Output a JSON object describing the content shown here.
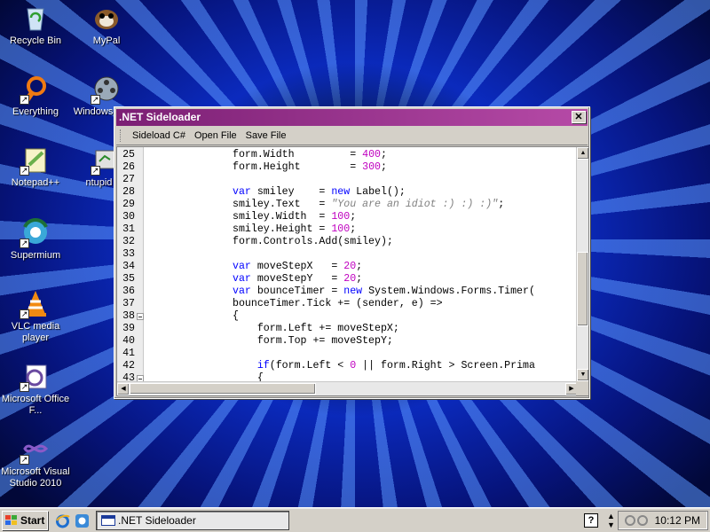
{
  "desktop": {
    "icons": [
      {
        "label": "Recycle Bin",
        "icon": "recycle-bin-icon"
      },
      {
        "label": "MyPal",
        "icon": "mypal-icon"
      },
      {
        "label": "Everything",
        "icon": "everything-icon"
      },
      {
        "label": "Windows Make",
        "icon": "movie-maker-icon"
      },
      {
        "label": "Notepad++",
        "icon": "notepadpp-icon"
      },
      {
        "label": "ntupid sig",
        "icon": "ntupid-icon"
      },
      {
        "label": "Supermium",
        "icon": "supermium-icon"
      },
      {
        "label": "VLC media player",
        "icon": "vlc-icon"
      },
      {
        "label": "Microsoft Office F...",
        "icon": "office-icon"
      },
      {
        "label": "Microsoft Visual Studio 2010",
        "icon": "visual-studio-icon"
      }
    ]
  },
  "window": {
    "title": ".NET Sideloader",
    "close_glyph": "✕",
    "menu": [
      "Sideload C#",
      "Open File",
      "Save File"
    ]
  },
  "editor": {
    "lines": [
      {
        "n": "25",
        "code": "form.Width         = 400;"
      },
      {
        "n": "26",
        "code": "form.Height        = 300;"
      },
      {
        "n": "27",
        "code": ""
      },
      {
        "n": "28",
        "code": "var smiley    = new Label();"
      },
      {
        "n": "29",
        "code": "smiley.Text   = \"You are an idiot :) :) :)\";"
      },
      {
        "n": "30",
        "code": "smiley.Width  = 100;"
      },
      {
        "n": "31",
        "code": "smiley.Height = 100;"
      },
      {
        "n": "32",
        "code": "form.Controls.Add(smiley);"
      },
      {
        "n": "33",
        "code": ""
      },
      {
        "n": "34",
        "code": "var moveStepX   = 20;"
      },
      {
        "n": "35",
        "code": "var moveStepY   = 20;"
      },
      {
        "n": "36",
        "code": "var bounceTimer = new System.Windows.Forms.Timer("
      },
      {
        "n": "37",
        "code": "bounceTimer.Tick += (sender, e) =>"
      },
      {
        "n": "38",
        "code": "{"
      },
      {
        "n": "39",
        "code": "    form.Left += moveStepX;"
      },
      {
        "n": "40",
        "code": "    form.Top += moveStepY;"
      },
      {
        "n": "41",
        "code": ""
      },
      {
        "n": "42",
        "code": "    if(form.Left < 0 || form.Right > Screen.Prima"
      },
      {
        "n": "43",
        "code": "    {"
      }
    ]
  },
  "taskbar": {
    "start_label": "Start",
    "task_label": ".NET Sideloader",
    "help_glyph": "?",
    "clock": "10:12 PM"
  },
  "colors": {
    "title_start": "#7b1f74",
    "title_end": "#b64aa7",
    "keyword": "#0000ff",
    "number": "#c000c0",
    "string": "#808080"
  }
}
